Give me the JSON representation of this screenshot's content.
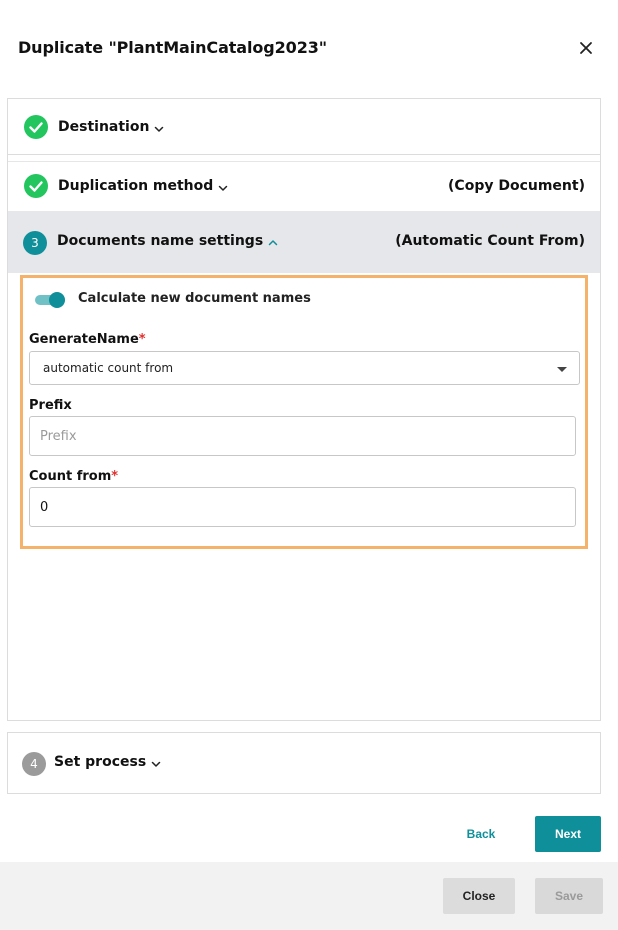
{
  "dialog": {
    "title": "Duplicate \"PlantMainCatalog2023\""
  },
  "steps": [
    {
      "label": "Destination",
      "status": "complete",
      "summary": ""
    },
    {
      "label": "Duplication method",
      "status": "complete",
      "summary": "(Copy Document)"
    },
    {
      "number": "3",
      "label": "Documents name settings",
      "status": "active",
      "summary": "(Automatic Count From)"
    },
    {
      "number": "4",
      "label": "Set process",
      "status": "pending",
      "summary": ""
    }
  ],
  "name_settings": {
    "toggle_label": "Calculate new document names",
    "toggle_on": true,
    "generate_name": {
      "label": "GenerateName",
      "required_mark": "*",
      "selected": "automatic count from"
    },
    "prefix": {
      "label": "Prefix",
      "placeholder": "Prefix",
      "value": ""
    },
    "count_from": {
      "label": "Count from",
      "required_mark": "*",
      "value": "0"
    }
  },
  "actions": {
    "back": "Back",
    "next": "Next",
    "close": "Close",
    "save": "Save"
  },
  "colors": {
    "accent": "#0f8f99",
    "success": "#22c55e",
    "highlight_border": "#f5b26b",
    "required": "#e0302f"
  }
}
